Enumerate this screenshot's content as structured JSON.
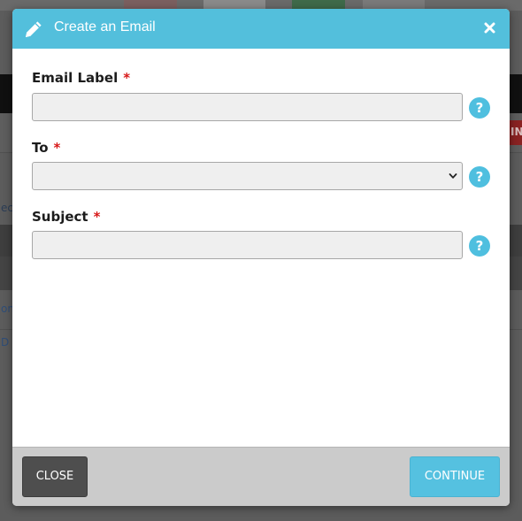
{
  "modal": {
    "title": "Create an Email",
    "header_color": "#53bfdc",
    "header_icon": "pencil-icon",
    "close_icon": "close-icon"
  },
  "form": {
    "fields": [
      {
        "label": "Email Label",
        "required_mark": "*",
        "type": "text",
        "value": ""
      },
      {
        "label": "To",
        "required_mark": "*",
        "type": "select",
        "value": ""
      },
      {
        "label": "Subject",
        "required_mark": "*",
        "type": "text",
        "value": ""
      }
    ],
    "help_icon": "question-mark-icon",
    "help_glyph": "?",
    "help_color": "#4fbfdf",
    "required_color": "#d71818"
  },
  "footer": {
    "close_label": "CLOSE",
    "continue_label": "CONTINUE",
    "close_color": "#4e4e4e",
    "continue_color": "#55c1e0"
  },
  "background": {
    "partial_button_text": "IN",
    "partial_text_1": "ec",
    "partial_text_2": "on",
    "partial_text_3": "D A"
  }
}
